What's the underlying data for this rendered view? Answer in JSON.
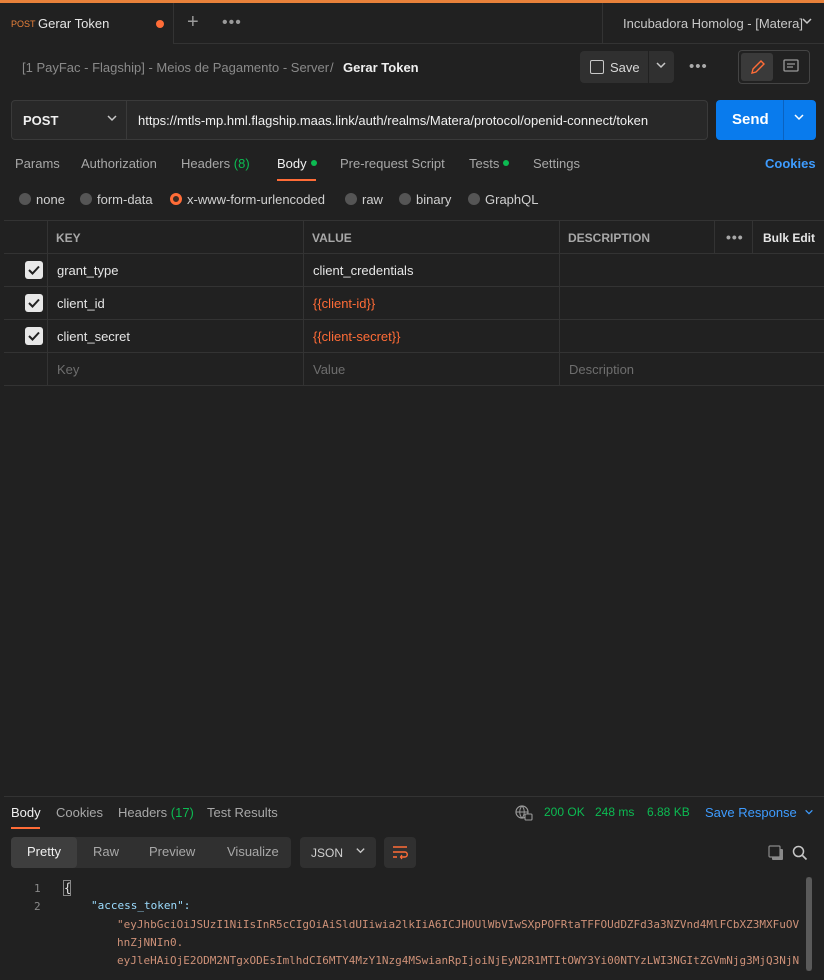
{
  "tabs": {
    "active": {
      "method": "POST",
      "title": "Gerar Token"
    },
    "environment": "Incubadora Homolog - [Matera]"
  },
  "breadcrumb": {
    "path": "[1 PayFac - Flagship] - Meios de Pagamento - Server",
    "separator": "/",
    "current": "Gerar Token",
    "save_label": "Save"
  },
  "request": {
    "method": "POST",
    "url": "https://mtls-mp.hml.flagship.maas.link/auth/realms/Matera/protocol/openid-connect/token",
    "send_label": "Send",
    "tabs": [
      "Params",
      "Authorization",
      "Headers",
      "Body",
      "Pre-request Script",
      "Tests",
      "Settings"
    ],
    "headers_count": "(8)",
    "cookies_label": "Cookies"
  },
  "body_types": [
    "none",
    "form-data",
    "x-www-form-urlencoded",
    "raw",
    "binary",
    "GraphQL"
  ],
  "body_table": {
    "headers": {
      "key": "KEY",
      "value": "VALUE",
      "description": "DESCRIPTION",
      "bulk_edit": "Bulk Edit"
    },
    "rows": [
      {
        "key": "grant_type",
        "value": "client_credentials"
      },
      {
        "key": "client_id",
        "value": "{{client-id}}"
      },
      {
        "key": "client_secret",
        "value": "{{client-secret}}"
      }
    ],
    "placeholders": {
      "key": "Key",
      "value": "Value",
      "description": "Description"
    }
  },
  "response": {
    "tabs": [
      "Body",
      "Cookies",
      "Headers",
      "Test Results"
    ],
    "headers_count": "(17)",
    "status": "200 OK",
    "time": "248 ms",
    "size": "6.88 KB",
    "save_response": "Save Response",
    "view_tabs": [
      "Pretty",
      "Raw",
      "Preview",
      "Visualize"
    ],
    "format": "JSON",
    "lines": [
      "1",
      "2"
    ],
    "json_key": "\"access_token\":",
    "json_value_lines": [
      "\"eyJhbGciOiJSUzI1NiIsInR5cCIgOiAiSldUIiwia2lkIiA6ICJHOUlWbVIwSXpPOFRtaTFFOUdDZFd3a3NZVnd4MlFCbXZ3MXFuOV",
      "hnZjNNIn0.",
      "eyJleHAiOjE2ODM2NTgxODEsImlhdCI6MTY4MzY1Nzg4MSwianRpIjoiNjEyN2R1MTItOWY3Yi00NTYzLWI3NGItZGVmNjg3MjQ3NjN"
    ]
  },
  "colors": {
    "accent": "#ff6c37",
    "send": "#097bed",
    "status_ok": "#0cbb52",
    "link": "#3e9cff"
  }
}
